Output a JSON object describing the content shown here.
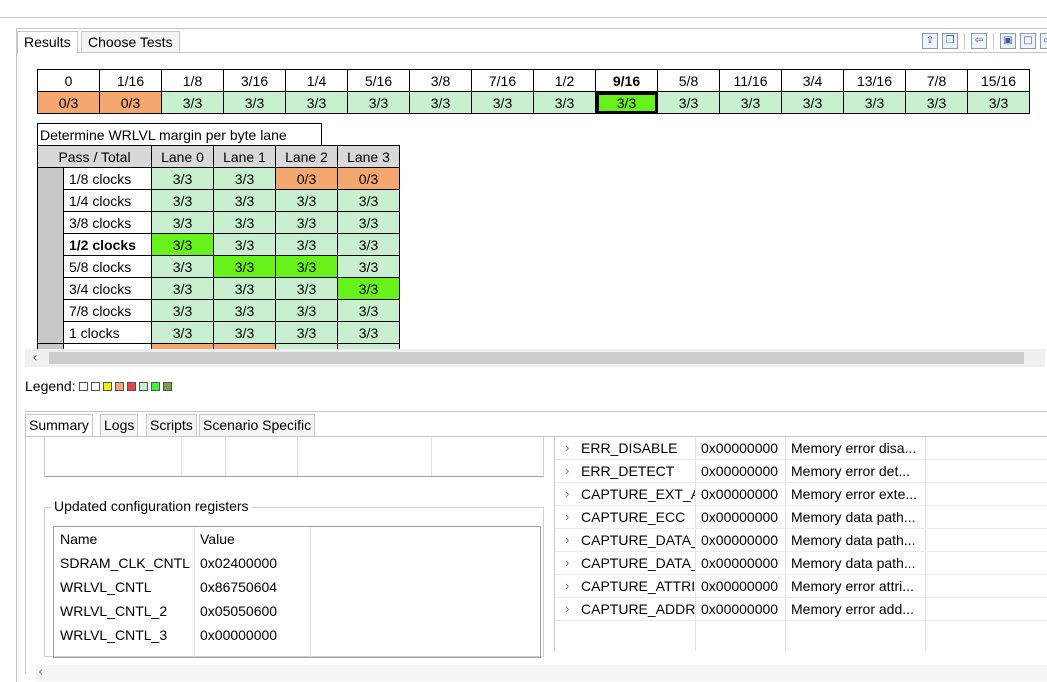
{
  "tabs": {
    "results": "Results",
    "choose_tests": "Choose Tests"
  },
  "fractions": {
    "headers": [
      "0",
      "1/16",
      "1/8",
      "3/16",
      "1/4",
      "5/16",
      "3/8",
      "7/16",
      "1/2",
      "9/16",
      "5/8",
      "11/16",
      "3/4",
      "13/16",
      "7/8",
      "15/16"
    ],
    "values": [
      "0/3",
      "0/3",
      "3/3",
      "3/3",
      "3/3",
      "3/3",
      "3/3",
      "3/3",
      "3/3",
      "3/3",
      "3/3",
      "3/3",
      "3/3",
      "3/3",
      "3/3",
      "3/3"
    ]
  },
  "lane_table": {
    "title": "Determine WRLVL margin per byte lane",
    "col_header": "Pass / Total",
    "lanes": [
      "Lane 0",
      "Lane 1",
      "Lane 2",
      "Lane 3"
    ],
    "rows": [
      {
        "label": "1/8 clocks",
        "v": [
          "3/3",
          "3/3",
          "0/3",
          "0/3"
        ]
      },
      {
        "label": "1/4 clocks",
        "v": [
          "3/3",
          "3/3",
          "3/3",
          "3/3"
        ]
      },
      {
        "label": "3/8 clocks",
        "v": [
          "3/3",
          "3/3",
          "3/3",
          "3/3"
        ]
      },
      {
        "label": "1/2 clocks",
        "v": [
          "3/3",
          "3/3",
          "3/3",
          "3/3"
        ]
      },
      {
        "label": "5/8 clocks",
        "v": [
          "3/3",
          "3/3",
          "3/3",
          "3/3"
        ]
      },
      {
        "label": "3/4 clocks",
        "v": [
          "3/3",
          "3/3",
          "3/3",
          "3/3"
        ]
      },
      {
        "label": "7/8 clocks",
        "v": [
          "3/3",
          "3/3",
          "3/3",
          "3/3"
        ]
      },
      {
        "label": "1 clocks",
        "v": [
          "3/3",
          "3/3",
          "3/3",
          "3/3"
        ]
      }
    ]
  },
  "legend": {
    "label": "Legend:"
  },
  "bottom_tabs": {
    "summary": "Summary",
    "logs": "Logs",
    "scripts": "Scripts",
    "scenario": "Scenario Specific"
  },
  "config": {
    "title": "Updated configuration registers",
    "col_name": "Name",
    "col_value": "Value",
    "rows": [
      {
        "name": "SDRAM_CLK_CNTL",
        "value": "0x02400000"
      },
      {
        "name": "WRLVL_CNTL",
        "value": "0x86750604"
      },
      {
        "name": "WRLVL_CNTL_2",
        "value": "0x05050600"
      },
      {
        "name": "WRLVL_CNTL_3",
        "value": "0x00000000"
      }
    ]
  },
  "errors": [
    {
      "name": "ERR_DISABLE",
      "value": "0x00000000",
      "desc": "Memory error disa..."
    },
    {
      "name": "ERR_DETECT",
      "value": "0x00000000",
      "desc": "Memory error det..."
    },
    {
      "name": "CAPTURE_EXT_AD",
      "value": "0x00000000",
      "desc": "Memory error exte..."
    },
    {
      "name": "CAPTURE_ECC",
      "value": "0x00000000",
      "desc": "Memory data path..."
    },
    {
      "name": "CAPTURE_DATA_I",
      "value": "0x00000000",
      "desc": "Memory data path..."
    },
    {
      "name": "CAPTURE_DATA_I",
      "value": "0x00000000",
      "desc": "Memory data path..."
    },
    {
      "name": "CAPTURE_ATTRIB",
      "value": "0x00000000",
      "desc": "Memory error attri..."
    },
    {
      "name": "CAPTURE_ADDRE",
      "value": "0x00000000",
      "desc": "Memory error add..."
    }
  ],
  "colors": {
    "pass": "#c8f0d0",
    "fail": "#f4a870",
    "highlight": "#66f21a"
  }
}
